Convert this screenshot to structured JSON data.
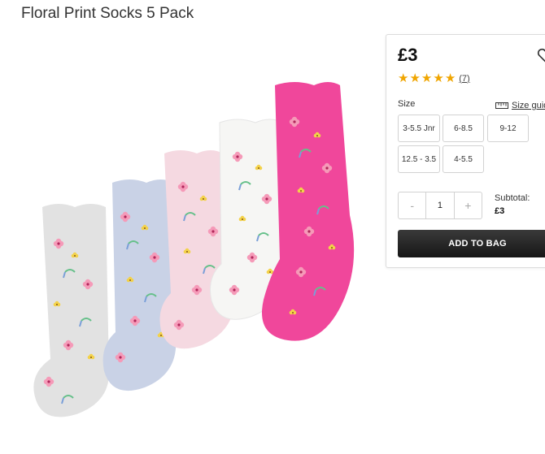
{
  "product": {
    "title": "Floral Print Socks 5 Pack",
    "price": "£3",
    "rating": {
      "stars": 5,
      "count_label": "(7)"
    },
    "star_color": "#f0a500",
    "sock_colors": [
      "#e2e2e2",
      "#c9d2e6",
      "#f5d9e1",
      "#f6f6f4",
      "#f0479b"
    ]
  },
  "size_picker": {
    "label": "Size",
    "guide_label": "Size guide",
    "options": [
      "3-5.5 Jnr",
      "6-8.5",
      "9-12",
      "12.5 - 3.5",
      "4-5.5"
    ]
  },
  "quantity": {
    "minus": "-",
    "value": "1",
    "plus": "+"
  },
  "subtotal": {
    "label": "Subtotal:",
    "value": "£3"
  },
  "add_to_bag": {
    "label": "ADD TO BAG",
    "color": "#1f1f1f"
  }
}
